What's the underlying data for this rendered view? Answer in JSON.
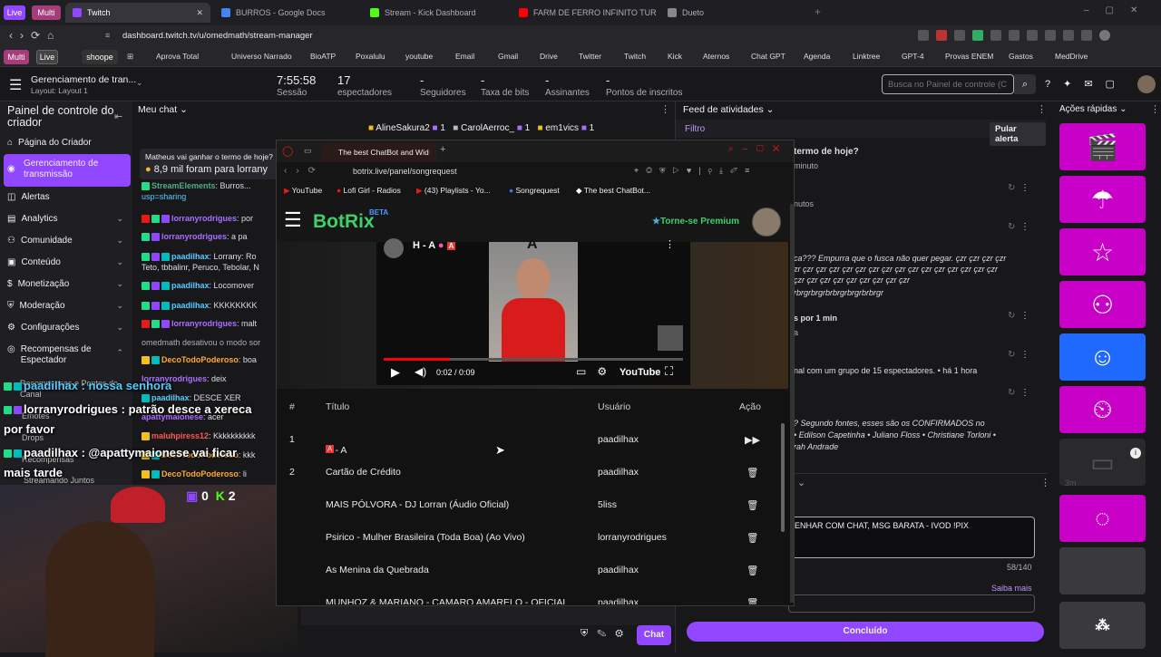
{
  "browser": {
    "pills": [
      "Live",
      "Multi"
    ],
    "tabs": [
      "Twitch",
      "BURROS - Google Docs",
      "Stream - Kick Dashboard",
      "FARM DE FERRO INFINITO TURBI...",
      "Dueto"
    ],
    "url": "dashboard.twitch.tv/u/omedmath/stream-manager",
    "bm_pills": [
      "Multi",
      "Live",
      "shoope"
    ],
    "bookmarks": [
      "Aprova Total",
      "Universo Narrado",
      "BioATP",
      "Poxalulu",
      "youtube",
      "Email",
      "Gmail",
      "Drive",
      "Twitter",
      "Twitch",
      "Kick",
      "Aternos",
      "Chat GPT",
      "Agenda",
      "Linktree",
      "GPT-4",
      "Provas ENEM",
      "Gastos",
      "MedDrive"
    ]
  },
  "header": {
    "title": "Gerenciamento de tran...",
    "layout": "Layout: Layout 1",
    "session_value": "7:55:58",
    "session_label": "Sessão",
    "viewers_value": "17",
    "viewers_label": "espectadores",
    "dash": "-",
    "followers_label": "Seguidores",
    "bitrate_label": "Taxa de bits",
    "subs_label": "Assinantes",
    "sub_points_label": "Pontos de inscritos",
    "search_placeholder": "Busca no Painel de controle (C"
  },
  "sidebar": {
    "title": "Painel de controle do criador",
    "items": [
      "Página do Criador",
      "Gerenciamento de transmissão",
      "Alertas",
      "Analytics",
      "Comunidade",
      "Conteúdo",
      "Monetização",
      "Moderação",
      "Configurações",
      "Recompensas de Espectador",
      "Recompensas e Pontos do Canal",
      "Emotes",
      "Drops",
      "Recompensas",
      "Streamando Juntos"
    ]
  },
  "chat": {
    "title": "Meu chat",
    "gifters": [
      "AlineSakura2",
      "1",
      "CarolAerroc_",
      "1",
      "em1vics",
      "1"
    ],
    "pinned_1": "Matheus vai ganhar o termo de hoje?",
    "pinned_2": "8,9 mil foram para lorrany",
    "lines": [
      {
        "user": "StreamElements",
        "text": ": Burros..."
      },
      {
        "user": "",
        "text": "usp=sharing"
      },
      {
        "user": "lorranyrodrigues",
        "text": ": por"
      },
      {
        "user": "lorranyrodrigues",
        "text": ": a pa"
      },
      {
        "user": "paadilhax",
        "text": ": Lorrany: Ro"
      },
      {
        "user": "",
        "text": "Teto, tbbalinr, Peruco, Tebolar, N"
      },
      {
        "user": "paadilhax",
        "text": ": Locomover"
      },
      {
        "user": "paadilhax",
        "text": ": KKKKKKKK"
      },
      {
        "user": "lorranyrodrigues",
        "text": ": malt"
      },
      {
        "user": "",
        "text": "omedmath desativou o modo sor"
      },
      {
        "user": "DecoTodoPoderoso",
        "text": ": boa"
      },
      {
        "user": "lorranyrodrigues",
        "text": ": deix"
      },
      {
        "user": "paadilhax",
        "text": ": DESCE XER"
      },
      {
        "user": "apattymaionese",
        "text": ": acer"
      },
      {
        "user": "maluhpiress12",
        "text": ": Kkkkkkkkkk"
      },
      {
        "user": "DecoTodoPoderoso",
        "text": ": kkk"
      },
      {
        "user": "DecoTodoPoderoso",
        "text": ": li"
      }
    ],
    "overlay_1a": "paadilhax : nossa senhora",
    "overlay_2": "lorranyrodrigues : patrão desce a xereca",
    "overlay_2b": "por favor",
    "overlay_3": "paadilhax : @apattymaionese vai ficar",
    "overlay_3b": "mais tarde",
    "webcam_badges": [
      "0",
      "2"
    ],
    "chat_button": "Chat"
  },
  "feed": {
    "title": "Feed de atividades",
    "filter": "Filtro",
    "skip": "Pular alerta",
    "items": [
      "termo de hoje?",
      "minuto",
      "nutos",
      "ca??? Empurra que o fusca não quer pegar. çzr çzr çzr çzr",
      "zr çzr çzr çzr çzr çzr çzr çzr çzr çzr çzr çzr çzr çzr çzr çzr",
      "çzr çzr çzr çzr çzr çzr çzr çzr çzr",
      "rbrgrbrgrbrbrgrbrgrbrbrgr",
      "s por 1 min",
      "a",
      "nal com um grupo de 15 espectadores. • há 1 hora",
      "? Segundo fontes, esses são os CONFIRMADOS no",
      "• Edilson Capetinha • Juliano Floss • Christiane Torloni •",
      "rah Andrade"
    ],
    "title_box": "ENHAR COM CHAT, MSG BARATA - IVOD !PIX",
    "counter": "58/140",
    "learn_more": "Saiba mais",
    "done": "Concluído"
  },
  "quick": {
    "title": "Ações rápidas",
    "colors": {
      "magenta": "#c800c8",
      "purple": "#9147ff",
      "blue": "#1f69ff",
      "grey": "#3a3a3d"
    },
    "side_label": "3m"
  },
  "popup": {
    "tab": "The best ChatBot and Wid",
    "url": "botrix.live/panel/songrequest",
    "bookmarks": [
      "YouTube",
      "Lofi Girl - Radios",
      "(43) Playlists - Yo...",
      "Songrequest",
      "The best ChatBot..."
    ],
    "brand": "BotRix",
    "beta": "BETA",
    "premium": "Torne-se Premium",
    "video_title": "H - A",
    "video_letter": "A",
    "video_time": "0:02 / 0:09",
    "video_progress": 0.22,
    "youtube": "YouTube",
    "col_num": "#",
    "col_title": "Título",
    "col_user": "Usuário",
    "col_action": "Ação",
    "songs": [
      {
        "n": "1",
        "title": "H - A",
        "user": "paadilhax",
        "action": "play"
      },
      {
        "n": "2",
        "title": "Cartão de Crédito",
        "user": "paadilhax",
        "action": "delete"
      },
      {
        "n": "",
        "title": "MAIS PÓLVORA - DJ Lorran (Áudio Oficial)",
        "user": "5liss",
        "action": "delete"
      },
      {
        "n": "",
        "title": "Psirico - Mulher Brasileira (Toda Boa) (Ao Vivo)",
        "user": "lorranyrodrigues",
        "action": "delete"
      },
      {
        "n": "",
        "title": "As Menina da Quebrada",
        "user": "paadilhax",
        "action": "delete"
      },
      {
        "n": "",
        "title": "MUNHOZ & MARIANO - CAMARO AMARELO - OFICIAL",
        "user": "paadilhax",
        "action": "delete"
      }
    ]
  }
}
